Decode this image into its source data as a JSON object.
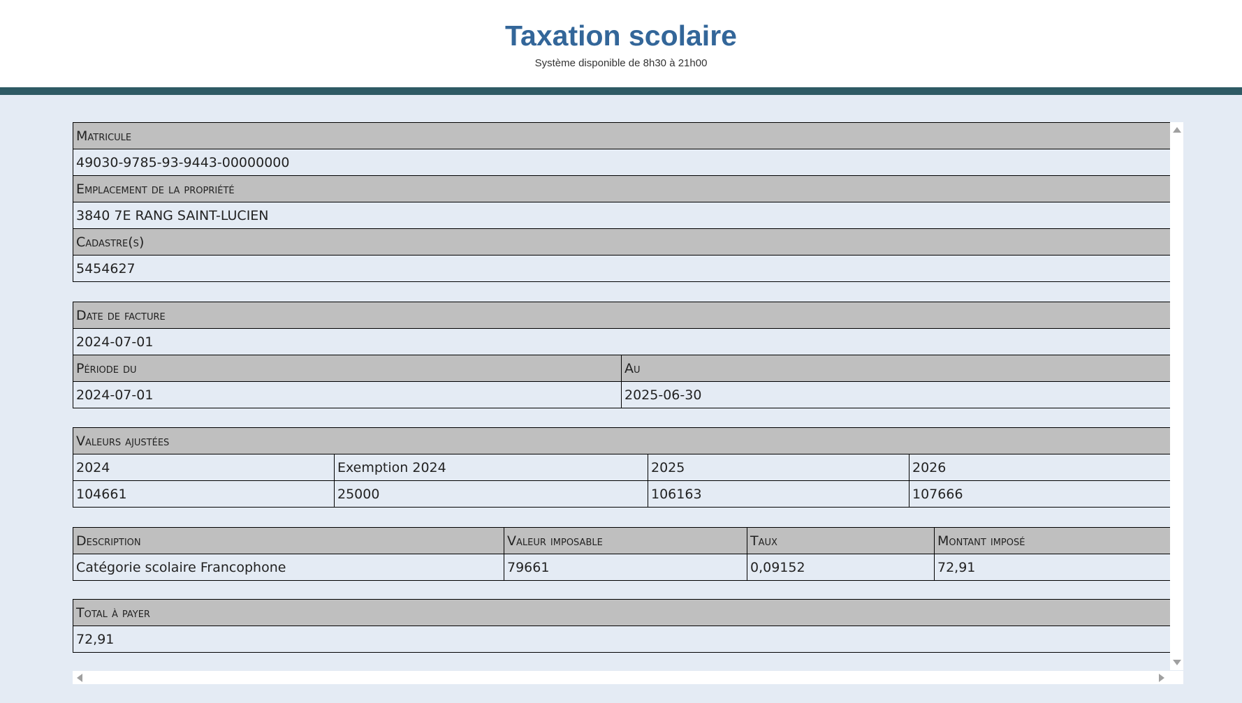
{
  "header": {
    "title": "Taxation scolaire",
    "subtitle": "Système disponible de 8h30 à 21h00"
  },
  "property": {
    "matricule_label": "Matricule",
    "matricule_value": "49030-9785-93-9443-00000000",
    "location_label": "Emplacement de la propriété",
    "location_value": "3840 7E RANG SAINT-LUCIEN",
    "cadastre_label": "Cadastre(s)",
    "cadastre_value": "5454627"
  },
  "invoice": {
    "date_label": "Date de facture",
    "date_value": "2024-07-01",
    "period_from_label": "Période du",
    "period_to_label": "Au",
    "period_from_value": "2024-07-01",
    "period_to_value": "2025-06-30"
  },
  "adjusted_values": {
    "label": "Valeurs ajustées",
    "headers": [
      "2024",
      "Exemption 2024",
      "2025",
      "2026"
    ],
    "values": [
      "104661",
      "25000",
      "106163",
      "107666"
    ]
  },
  "tax_detail": {
    "headers": [
      "Description",
      "Valeur imposable",
      "Taux",
      "Montant imposé"
    ],
    "row": [
      "Catégorie scolaire Francophone",
      "79661",
      "0,09152",
      "72,91"
    ]
  },
  "total": {
    "label": "Total à payer",
    "value": "72,91"
  },
  "colors": {
    "title": "#336699",
    "header_bar": "#2e5a64",
    "label_background": "#bfbfbf",
    "page_background": "#e4ebf4"
  },
  "icons": {
    "scroll_up": "scroll-up-arrow-icon",
    "scroll_down": "scroll-down-arrow-icon",
    "scroll_left": "scroll-left-arrow-icon",
    "scroll_right": "scroll-right-arrow-icon"
  }
}
